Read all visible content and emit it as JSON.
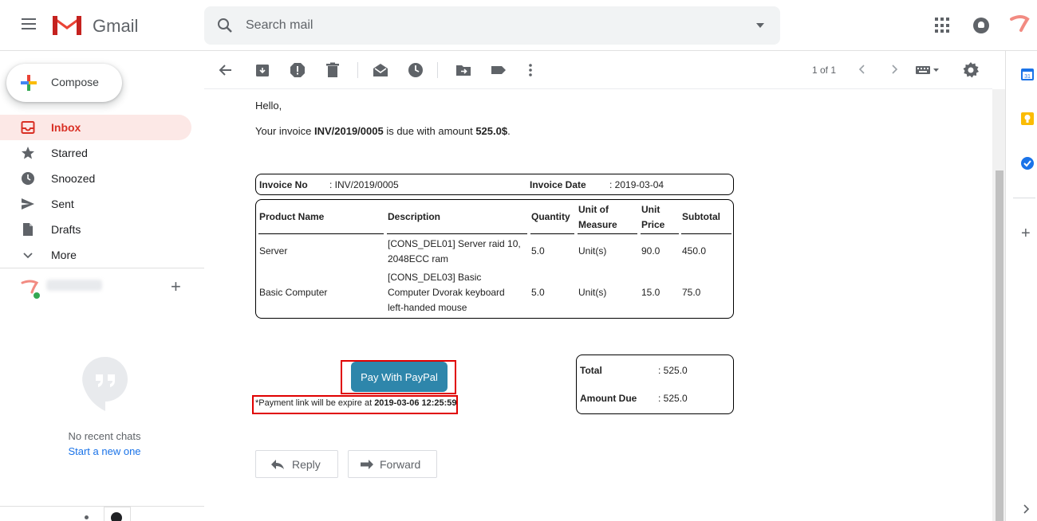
{
  "app": {
    "name": "Gmail"
  },
  "search": {
    "placeholder": "Search mail"
  },
  "compose": {
    "label": "Compose"
  },
  "nav": [
    {
      "label": "Inbox",
      "active": true
    },
    {
      "label": "Starred"
    },
    {
      "label": "Snoozed"
    },
    {
      "label": "Sent"
    },
    {
      "label": "Drafts"
    },
    {
      "label": "More"
    }
  ],
  "hangouts": {
    "no_chats": "No recent chats",
    "start_new": "Start a new one"
  },
  "toolbar": {
    "pager": "1 of 1"
  },
  "message": {
    "greeting": "Hello,",
    "due_prefix": "Your invoice ",
    "invoice_ref": "INV/2019/0005",
    "due_middle": " is due with amount ",
    "amount": "525.0$",
    "due_suffix": ".",
    "invoice_no_label": "Invoice No",
    "invoice_no_value": ": INV/2019/0005",
    "invoice_date_label": "Invoice Date",
    "invoice_date_value": ": 2019-03-04",
    "table": {
      "headers": [
        "Product Name",
        "Description",
        "Quantity",
        "Unit of Measure",
        "Unit Price",
        "Subtotal"
      ],
      "rows": [
        [
          "Server",
          "[CONS_DEL01] Server raid 10, 2048ECC ram",
          "5.0",
          "Unit(s)",
          "90.0",
          "450.0"
        ],
        [
          "Basic Computer",
          "[CONS_DEL03] Basic Computer Dvorak keyboard left-handed mouse",
          "5.0",
          "Unit(s)",
          "15.0",
          "75.0"
        ]
      ]
    },
    "pay_button": "Pay With PayPal",
    "expire_prefix": "*Payment link will be expire at ",
    "expire_time": "2019-03-06 12:25:59",
    "total_label": "Total",
    "total_value": ": 525.0",
    "amount_due_label": "Amount Due",
    "amount_due_value": ": 525.0",
    "reply": "Reply",
    "forward": "Forward"
  },
  "colors": {
    "accent_red": "#d93025",
    "paypal_blue": "#2e86ab",
    "highlight_red": "#e00000"
  }
}
